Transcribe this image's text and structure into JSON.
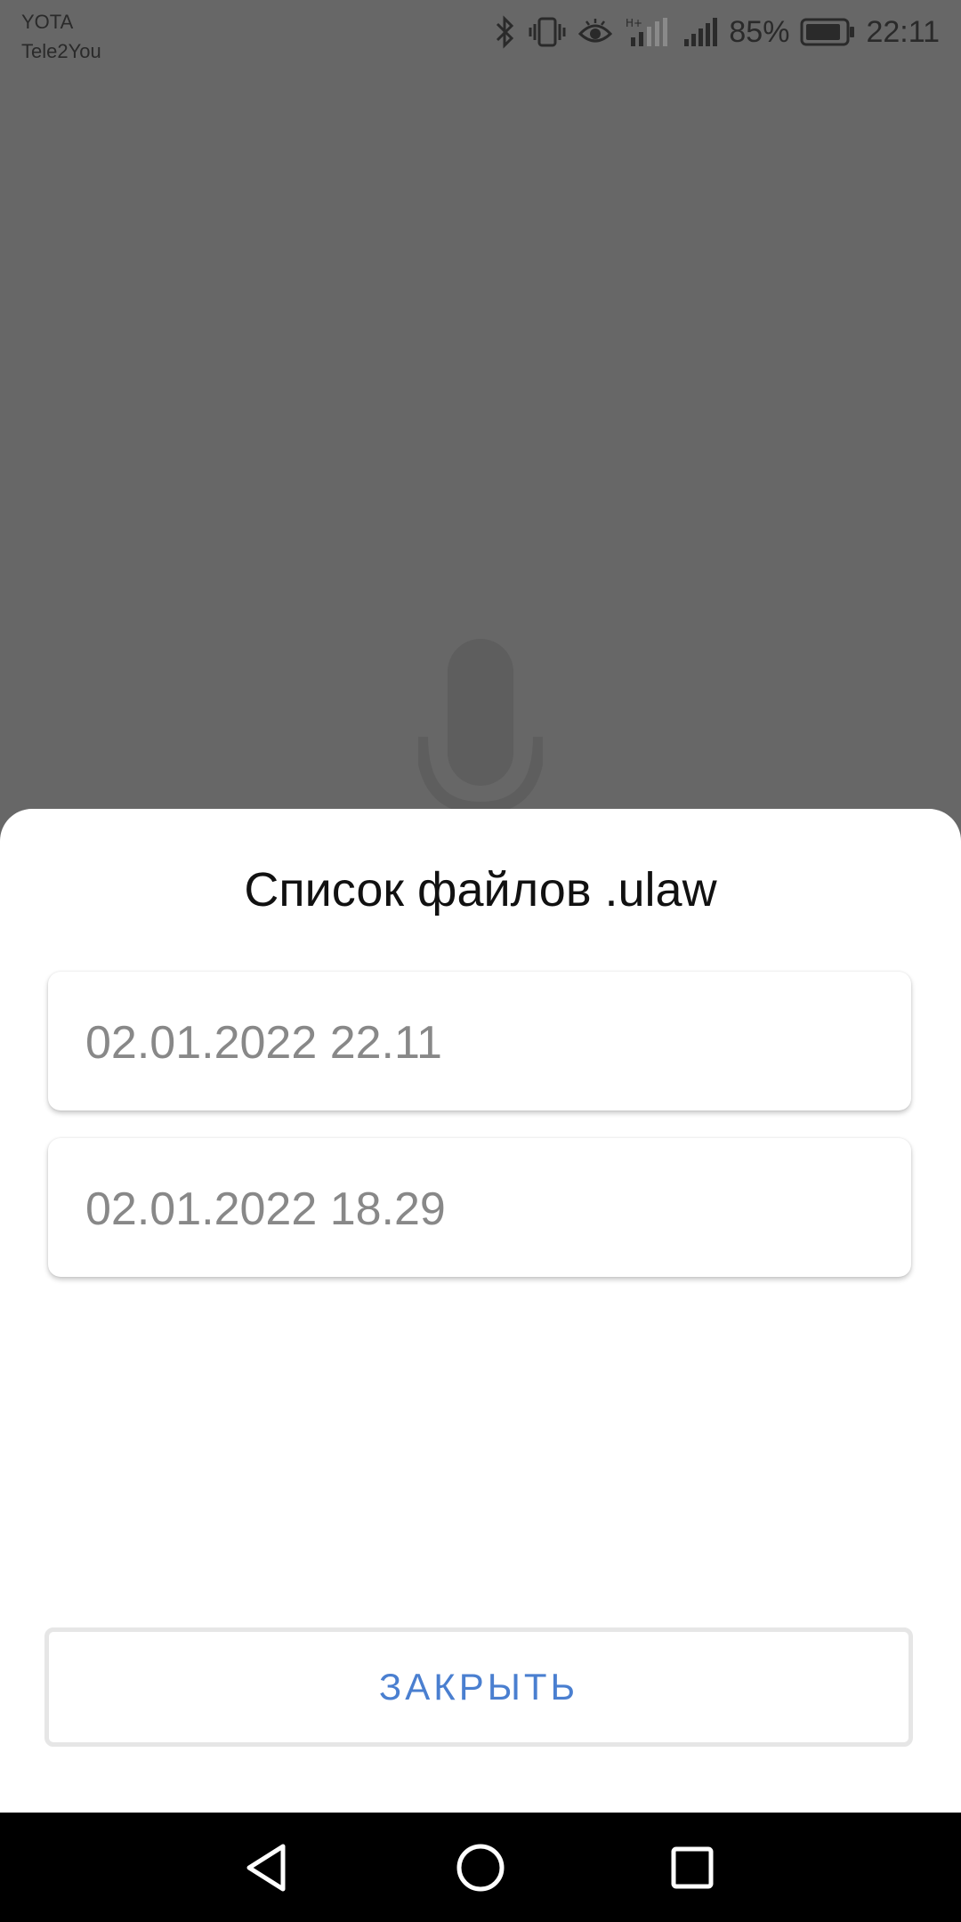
{
  "status_bar": {
    "carrier_1": "YOTA",
    "carrier_2": "Tele2You",
    "battery_percent": "85%",
    "time": "22:11",
    "icons": [
      "bluetooth-icon",
      "vibrate-icon",
      "eye-icon",
      "h-plus-signal-icon",
      "signal-icon",
      "battery-icon"
    ]
  },
  "background": {
    "icon": "microphone-icon"
  },
  "dialog": {
    "title": "Список файлов .ulaw",
    "files": [
      {
        "label": "02.01.2022 22.11"
      },
      {
        "label": "02.01.2022 18.29"
      }
    ],
    "close_label": "ЗАКРЫТЬ"
  },
  "nav_bar": {
    "icons": [
      "back-icon",
      "home-icon",
      "recents-icon"
    ]
  },
  "colors": {
    "scrim": "#676767",
    "sheet": "#ffffff",
    "accent": "#4a7fd0",
    "item_text": "#888888"
  }
}
